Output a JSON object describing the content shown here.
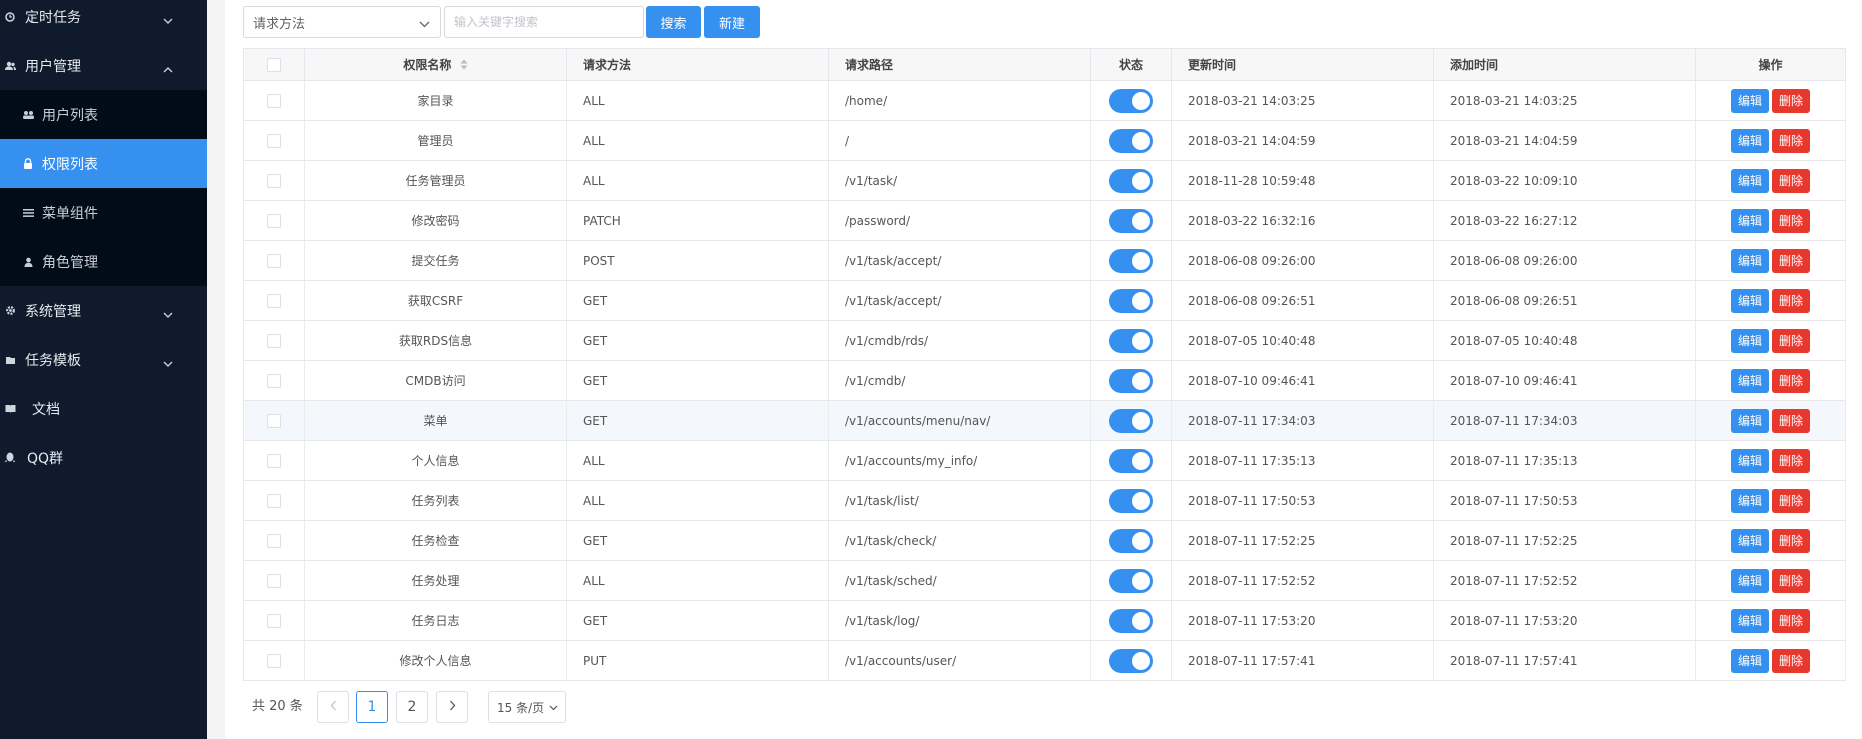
{
  "sidebar": {
    "items": [
      {
        "label": "定时任务",
        "icon": "clock-icon"
      },
      {
        "label": "用户管理",
        "icon": "users-icon"
      },
      {
        "label": "系统管理",
        "icon": "gear-icon"
      },
      {
        "label": "任务模板",
        "icon": "template-icon"
      },
      {
        "label": "文档",
        "icon": "book-icon"
      },
      {
        "label": "QQ群",
        "icon": "qq-icon"
      }
    ],
    "subitems": [
      {
        "label": "用户列表",
        "icon": "user-list-icon"
      },
      {
        "label": "权限列表",
        "icon": "lock-icon"
      },
      {
        "label": "菜单组件",
        "icon": "menu-lines-icon"
      },
      {
        "label": "角色管理",
        "icon": "person-icon"
      }
    ],
    "active_subitem": "权限列表"
  },
  "toolbar": {
    "method_select": "请求方法",
    "search_placeholder": "输入关键字搜索",
    "search_label": "搜索",
    "new_label": "新建"
  },
  "table": {
    "headers": {
      "name": "权限名称",
      "method": "请求方法",
      "path": "请求路径",
      "status": "状态",
      "updated": "更新时间",
      "added": "添加时间",
      "actions": "操作"
    },
    "edit_label": "编辑",
    "delete_label": "删除",
    "rows": [
      {
        "name": "家目录",
        "method": "ALL",
        "path": "/home/",
        "enabled": true,
        "updated": "2018-03-21 14:03:25",
        "added": "2018-03-21 14:03:25"
      },
      {
        "name": "管理员",
        "method": "ALL",
        "path": "/",
        "enabled": true,
        "updated": "2018-03-21 14:04:59",
        "added": "2018-03-21 14:04:59"
      },
      {
        "name": "任务管理员",
        "method": "ALL",
        "path": "/v1/task/",
        "enabled": true,
        "updated": "2018-11-28 10:59:48",
        "added": "2018-03-22 10:09:10"
      },
      {
        "name": "修改密码",
        "method": "PATCH",
        "path": "/password/",
        "enabled": true,
        "updated": "2018-03-22 16:32:16",
        "added": "2018-03-22 16:27:12"
      },
      {
        "name": "提交任务",
        "method": "POST",
        "path": "/v1/task/accept/",
        "enabled": true,
        "updated": "2018-06-08 09:26:00",
        "added": "2018-06-08 09:26:00"
      },
      {
        "name": "获取CSRF",
        "method": "GET",
        "path": "/v1/task/accept/",
        "enabled": true,
        "updated": "2018-06-08 09:26:51",
        "added": "2018-06-08 09:26:51"
      },
      {
        "name": "获取RDS信息",
        "method": "GET",
        "path": "/v1/cmdb/rds/",
        "enabled": true,
        "updated": "2018-07-05 10:40:48",
        "added": "2018-07-05 10:40:48"
      },
      {
        "name": "CMDB访问",
        "method": "GET",
        "path": "/v1/cmdb/",
        "enabled": true,
        "updated": "2018-07-10 09:46:41",
        "added": "2018-07-10 09:46:41"
      },
      {
        "name": "菜单",
        "method": "GET",
        "path": "/v1/accounts/menu/nav/",
        "enabled": true,
        "updated": "2018-07-11 17:34:03",
        "added": "2018-07-11 17:34:03"
      },
      {
        "name": "个人信息",
        "method": "ALL",
        "path": "/v1/accounts/my_info/",
        "enabled": true,
        "updated": "2018-07-11 17:35:13",
        "added": "2018-07-11 17:35:13"
      },
      {
        "name": "任务列表",
        "method": "ALL",
        "path": "/v1/task/list/",
        "enabled": true,
        "updated": "2018-07-11 17:50:53",
        "added": "2018-07-11 17:50:53"
      },
      {
        "name": "任务检查",
        "method": "GET",
        "path": "/v1/task/check/",
        "enabled": true,
        "updated": "2018-07-11 17:52:25",
        "added": "2018-07-11 17:52:25"
      },
      {
        "name": "任务处理",
        "method": "ALL",
        "path": "/v1/task/sched/",
        "enabled": true,
        "updated": "2018-07-11 17:52:52",
        "added": "2018-07-11 17:52:52"
      },
      {
        "name": "任务日志",
        "method": "GET",
        "path": "/v1/task/log/",
        "enabled": true,
        "updated": "2018-07-11 17:53:20",
        "added": "2018-07-11 17:53:20"
      },
      {
        "name": "修改个人信息",
        "method": "PUT",
        "path": "/v1/accounts/user/",
        "enabled": true,
        "updated": "2018-07-11 17:57:41",
        "added": "2018-07-11 17:57:41"
      }
    ]
  },
  "pagination": {
    "total": "共 20 条",
    "pages": [
      "1",
      "2"
    ],
    "current": "1",
    "page_size": "15 条/页"
  },
  "colors": {
    "sidebar_bg": "#0f1b2d",
    "submenu_bg": "#000c17",
    "primary": "#3590ef",
    "danger": "#e8382d"
  }
}
